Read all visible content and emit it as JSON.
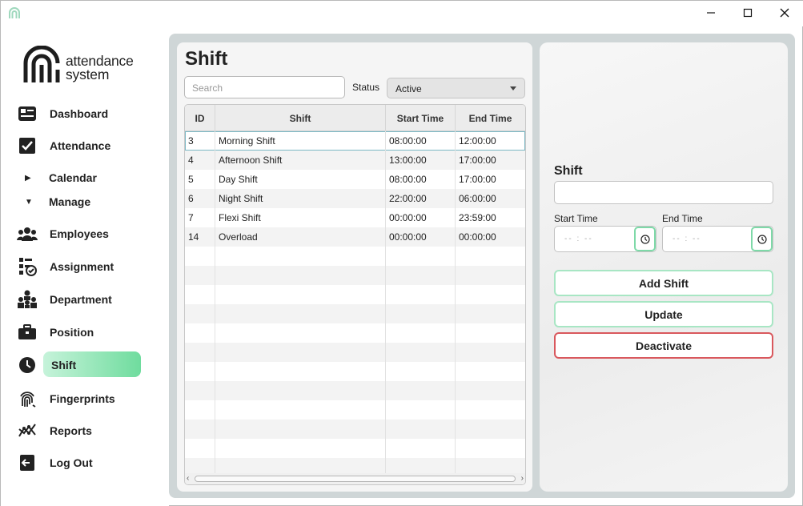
{
  "window": {
    "controls": [
      "minimize",
      "maximize",
      "close"
    ]
  },
  "brand": {
    "line1": "attendance",
    "line2": "system"
  },
  "sidebar": {
    "items": [
      {
        "label": "Dashboard",
        "icon": "dashboard-icon"
      },
      {
        "label": "Attendance",
        "icon": "checkbox-icon"
      },
      {
        "label": "Calendar",
        "icon": "triangle-right-icon"
      },
      {
        "label": "Manage",
        "icon": "triangle-down-icon"
      },
      {
        "label": "Employees",
        "icon": "people-icon"
      },
      {
        "label": "Assignment",
        "icon": "assignment-icon"
      },
      {
        "label": "Department",
        "icon": "department-icon"
      },
      {
        "label": "Position",
        "icon": "briefcase-icon"
      },
      {
        "label": "Shift",
        "icon": "clock-icon",
        "active": true
      },
      {
        "label": "Fingerprints",
        "icon": "fingerprint-icon"
      },
      {
        "label": "Reports",
        "icon": "reports-icon"
      },
      {
        "label": "Log Out",
        "icon": "logout-icon"
      }
    ]
  },
  "main": {
    "title": "Shift",
    "search_placeholder": "Search",
    "status_label": "Status",
    "status_value": "Active",
    "table": {
      "columns": [
        "ID",
        "Shift",
        "Start Time",
        "End Time"
      ],
      "rows": [
        [
          "3",
          "Morning Shift",
          "08:00:00",
          "12:00:00"
        ],
        [
          "4",
          "Afternoon Shift",
          "13:00:00",
          "17:00:00"
        ],
        [
          "5",
          "Day Shift",
          "08:00:00",
          "17:00:00"
        ],
        [
          "6",
          "Night Shift",
          "22:00:00",
          "06:00:00"
        ],
        [
          "7",
          "Flexi Shift",
          "00:00:00",
          "23:59:00"
        ],
        [
          "14",
          "Overload",
          "00:00:00",
          "00:00:00"
        ]
      ],
      "selected_row": 0
    }
  },
  "form": {
    "shift_label": "Shift",
    "shift_value": "",
    "start_time_label": "Start Time",
    "end_time_label": "End Time",
    "time_placeholder": "-- : --",
    "add_button": "Add Shift",
    "update_button": "Update",
    "deactivate_button": "Deactivate"
  },
  "colors": {
    "accent_green": "#6fdc9e",
    "danger_red": "#d9585d",
    "content_bg": "#cfd6d7"
  }
}
